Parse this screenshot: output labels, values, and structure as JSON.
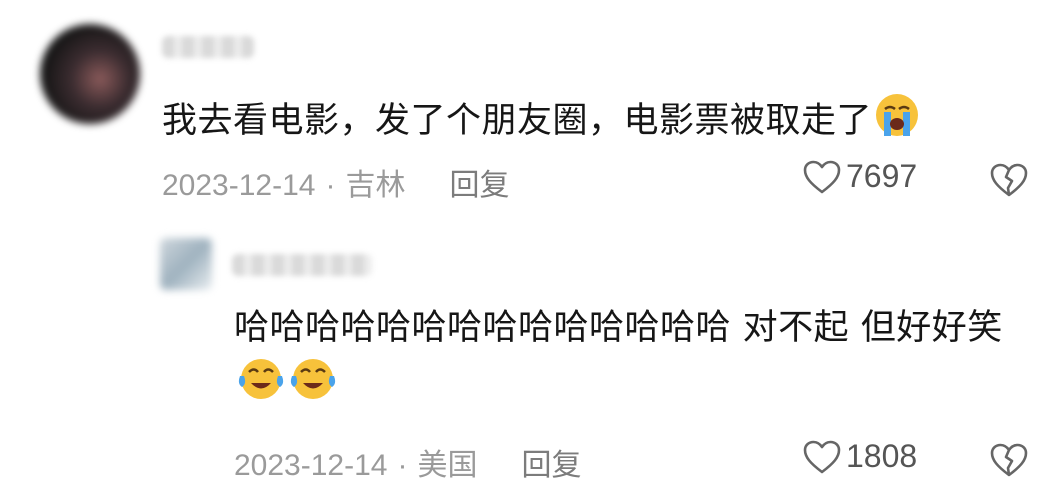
{
  "comments": [
    {
      "text": "我去看电影，发了个朋友圈，电影票被取走了",
      "emoji": [
        "crying-face-emoji"
      ],
      "date": "2023-12-14",
      "location": "吉林",
      "reply_label": "回复",
      "likes": "7697"
    },
    {
      "text": "哈哈哈哈哈哈哈哈哈哈哈哈哈哈 对不起 但好好笑",
      "emoji": [
        "tears-of-joy-emoji",
        "tears-of-joy-emoji"
      ],
      "date": "2023-12-14",
      "location": "美国",
      "reply_label": "回复",
      "likes": "1808"
    }
  ],
  "separator": "·",
  "colors": {
    "meta": "#9a9a9a",
    "text": "#161616",
    "emoji_face": "#f7c23b",
    "emoji_tear": "#4aa3ea"
  },
  "icons": [
    "heart-outline-icon",
    "broken-heart-icon"
  ]
}
